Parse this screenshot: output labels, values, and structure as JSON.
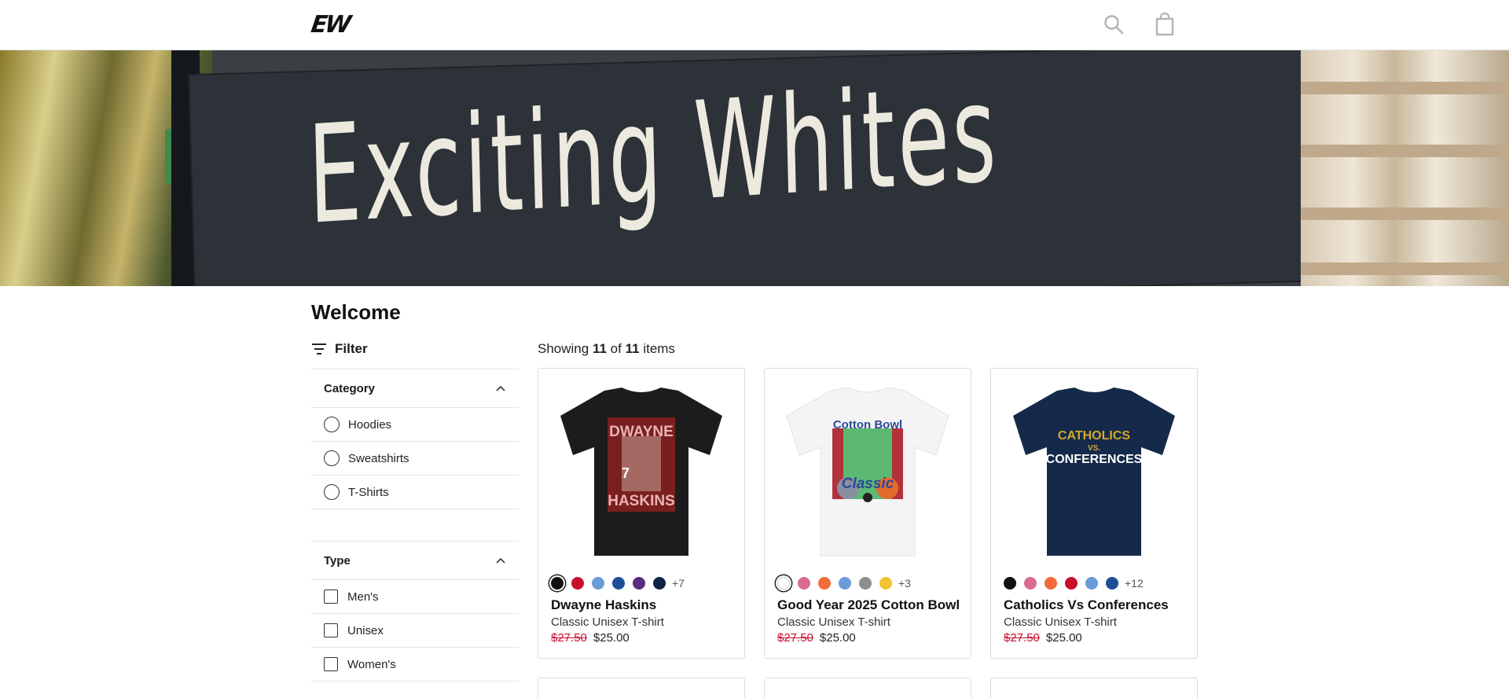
{
  "header": {
    "logo_text": "EW",
    "icons": [
      "search-icon",
      "shopping-bag-icon"
    ]
  },
  "hero": {
    "sign_text": "Exciting Whites"
  },
  "page": {
    "title": "Welcome"
  },
  "filter": {
    "label": "Filter",
    "groups": [
      {
        "title": "Category",
        "control": "radio",
        "options": [
          "Hoodies",
          "Sweatshirts",
          "T-Shirts"
        ]
      },
      {
        "title": "Type",
        "control": "checkbox",
        "options": [
          "Men's",
          "Unisex",
          "Women's"
        ]
      }
    ]
  },
  "results": {
    "prefix": "Showing",
    "shown": "11",
    "of": "of",
    "total": "11",
    "suffix": "items"
  },
  "products": [
    {
      "name": "Dwayne Haskins",
      "type": "Classic Unisex T-shirt",
      "old_price": "$27.50",
      "price": "$25.00",
      "shirt_color": "#1c1c1c",
      "graphic_text": [
        "DWAYNE",
        "HASKINS",
        "7"
      ],
      "swatches": [
        "#111111",
        "#c8102e",
        "#6a9bd8",
        "#1f4e99",
        "#5b2d82",
        "#0f2346"
      ],
      "more_colors": "+7"
    },
    {
      "name": "Good Year 2025 Cotton Bowl",
      "type": "Classic Unisex T-shirt",
      "old_price": "$27.50",
      "price": "$25.00",
      "shirt_color": "#f4f4f4",
      "graphic_text": [
        "Cotton Bowl",
        "Classic"
      ],
      "swatches": [
        "#ffffff",
        "#d96a92",
        "#f26b3a",
        "#6a9bd8",
        "#8e8e8e",
        "#f4c430"
      ],
      "more_colors": "+3"
    },
    {
      "name": "Catholics Vs Conferences",
      "type": "Classic Unisex T-shirt",
      "old_price": "$27.50",
      "price": "$25.00",
      "shirt_color": "#152a4a",
      "graphic_text": [
        "CATHOLICS",
        "VS.",
        "CONFERENCES"
      ],
      "swatches": [
        "#111111",
        "#d96a92",
        "#f26b3a",
        "#c8102e",
        "#6a9bd8",
        "#1f4e99"
      ],
      "more_colors": "+12"
    }
  ],
  "colors": {
    "sale_red": "#c8102e",
    "border": "#dcdcdc"
  }
}
